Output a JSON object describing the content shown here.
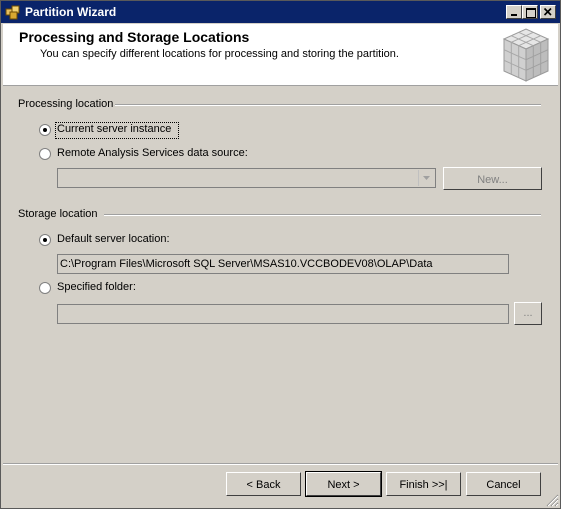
{
  "window": {
    "title": "Partition Wizard",
    "controls": [
      "minimize",
      "maximize",
      "close"
    ]
  },
  "header": {
    "title": "Processing and Storage Locations",
    "subtitle": "You can specify different locations for processing and storing the partition."
  },
  "processing": {
    "group_label": "Processing location",
    "option_current": "Current server instance",
    "option_remote": "Remote Analysis Services data source:",
    "datasource_value": "",
    "new_button": "New..."
  },
  "storage": {
    "group_label": "Storage location",
    "option_default": "Default server location:",
    "default_path": "C:\\Program Files\\Microsoft SQL Server\\MSAS10.VCCBODEV08\\OLAP\\Data",
    "option_specified": "Specified folder:",
    "specified_path": "",
    "browse_button": "..."
  },
  "footer": {
    "back": "< Back",
    "next": "Next >",
    "finish": "Finish >>|",
    "cancel": "Cancel"
  },
  "colors": {
    "titlebar": "#0a246a",
    "dialog_bg": "#d4d0c8",
    "header_bg": "#ffffff"
  }
}
